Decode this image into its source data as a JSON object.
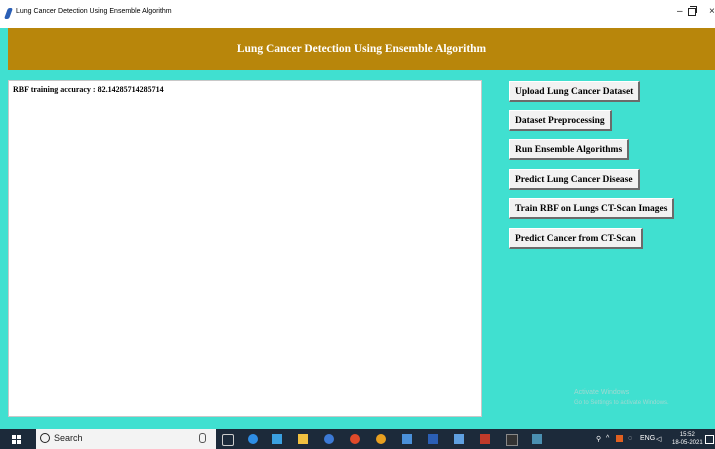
{
  "window": {
    "title": "Lung Cancer Detection Using Ensemble Algorithm",
    "minimize_glyph": "–",
    "close_glyph": "×"
  },
  "header": {
    "title": "Lung Cancer Detection Using Ensemble Algorithm",
    "background": "#b8860b"
  },
  "output": {
    "text": "RBF training accuracy : 82.14285714285714"
  },
  "buttons": [
    {
      "label": "Upload Lung Cancer Dataset"
    },
    {
      "label": "Dataset Preprocessing"
    },
    {
      "label": "Run Ensemble Algorithms"
    },
    {
      "label": "Predict Lung Cancer Disease"
    },
    {
      "label": "Train RBF on Lungs CT-Scan Images"
    },
    {
      "label": "Predict Cancer from CT-Scan"
    }
  ],
  "watermark": {
    "line1": "Activate Windows",
    "line2": "Go to Settings to activate Windows."
  },
  "taskbar": {
    "search_placeholder": "Search",
    "time": "15:52",
    "date": "18-05-2021",
    "language": "ENG"
  },
  "colors": {
    "background": "#40e0d0",
    "taskbar": "#1c2a3a"
  }
}
